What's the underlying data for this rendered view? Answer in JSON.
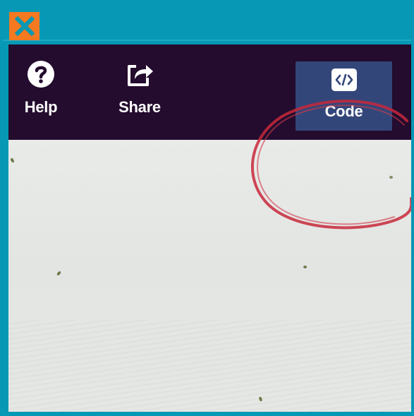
{
  "window": {
    "close_icon": "close-x-icon",
    "accent": "#0698b4",
    "close_color": "#f47920"
  },
  "toolbar": {
    "background": "#230c2e",
    "items": [
      {
        "label": "Help",
        "icon": "question-circle-icon"
      },
      {
        "label": "Share",
        "icon": "share-arrow-icon"
      },
      {
        "label": "Code",
        "icon": "code-brackets-icon",
        "selected": true
      }
    ]
  },
  "annotation": {
    "shape": "hand-drawn-circle",
    "color": "#c8283a"
  }
}
